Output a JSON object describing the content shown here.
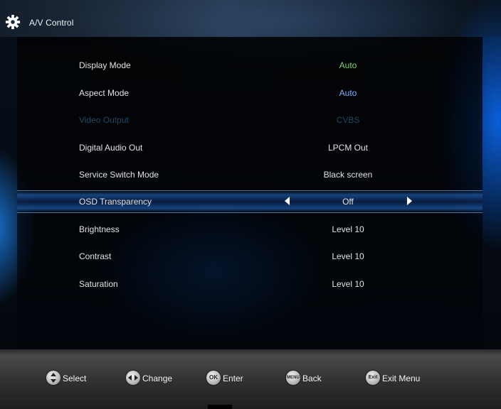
{
  "header": {
    "title": "A/V Control",
    "icon": "gear-icon"
  },
  "menu": [
    {
      "label": "Display Mode",
      "value": "Auto",
      "state": "green"
    },
    {
      "label": "Aspect Mode",
      "value": "Auto",
      "state": "blue"
    },
    {
      "label": "Video Output",
      "value": "CVBS",
      "state": "disabled"
    },
    {
      "label": "Digital Audio Out",
      "value": "LPCM Out",
      "state": "normal"
    },
    {
      "label": "Service Switch Mode",
      "value": "Black screen",
      "state": "normal"
    },
    {
      "label": "OSD Transparency",
      "value": "Off",
      "state": "selected"
    },
    {
      "label": "Brightness",
      "value": "Level 10",
      "state": "normal"
    },
    {
      "label": "Contrast",
      "value": "Level 10",
      "state": "normal"
    },
    {
      "label": "Saturation",
      "value": "Level 10",
      "state": "normal"
    }
  ],
  "footer": {
    "select": {
      "label": "Select",
      "icon": "up-down-icon"
    },
    "change": {
      "label": "Change",
      "icon": "left-right-icon"
    },
    "enter": {
      "label": "Enter",
      "button_text": "OK"
    },
    "back": {
      "label": "Back",
      "button_text": "MENU"
    },
    "exit": {
      "label": "Exit Menu",
      "button_text": "Exit"
    }
  },
  "colors": {
    "value_green": "#7fd86a",
    "value_blue": "#7fb2ff",
    "disabled": "#1f4a63",
    "highlight": "#2878dc"
  }
}
